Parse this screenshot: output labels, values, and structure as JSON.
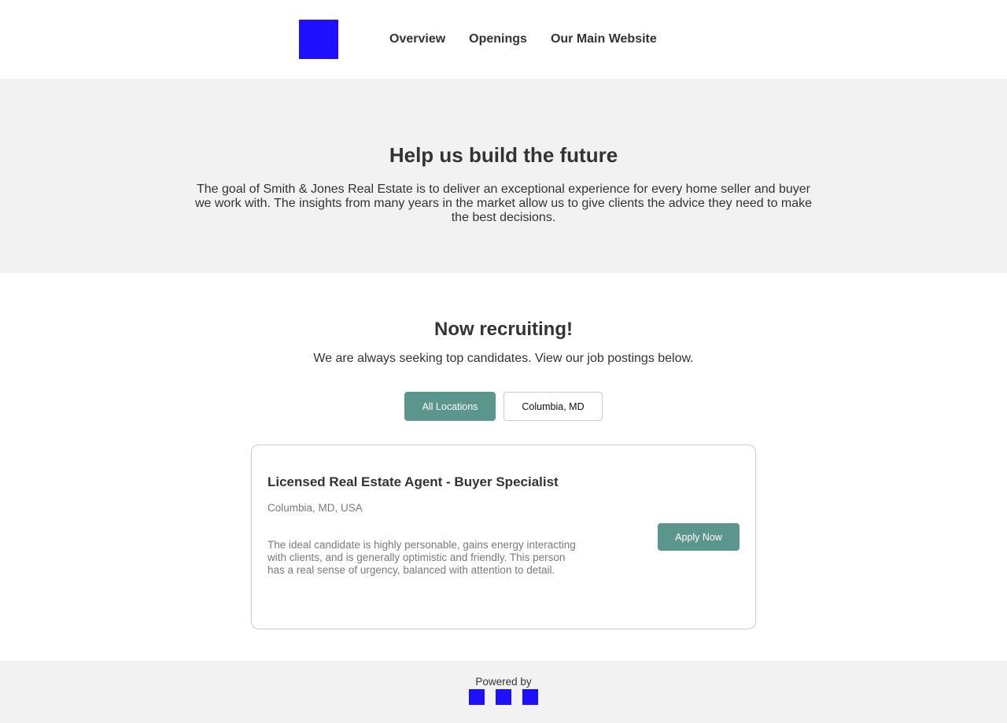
{
  "nav": {
    "logo": "company-logo",
    "items": [
      {
        "label": "Overview"
      },
      {
        "label": "Openings"
      },
      {
        "label": "Our Main Website"
      }
    ]
  },
  "hero": {
    "title": "Help us build the future",
    "body": "The goal of Smith & Jones Real Estate is to deliver an exceptional experience for every home seller and buyer we work with. The insights from many years in the market allow us to give clients the advice they need to make the best decisions."
  },
  "recruiting": {
    "title": "Now recruiting!",
    "subtitle": "We are always seeking top candidates. View our job postings below.",
    "filters": [
      {
        "label": "All Locations",
        "active": true
      },
      {
        "label": "Columbia, MD",
        "active": false
      }
    ]
  },
  "job": {
    "title": "Licensed Real Estate Agent - Buyer Specialist",
    "location": "Columbia, MD, USA",
    "description": "The ideal candidate is highly personable, gains energy interacting with clients, and is generally optimistic and friendly. This person has a real sense of urgency, balanced with attention to detail.",
    "apply_label": "Apply Now"
  },
  "footer": {
    "powered_by": "Powered by",
    "icons": [
      "brand-icon",
      "brand-icon",
      "brand-icon"
    ]
  },
  "colors": {
    "accent": "#5a968c",
    "logo_placeholder": "#1f0fff",
    "band_background": "#f2f2f2"
  }
}
